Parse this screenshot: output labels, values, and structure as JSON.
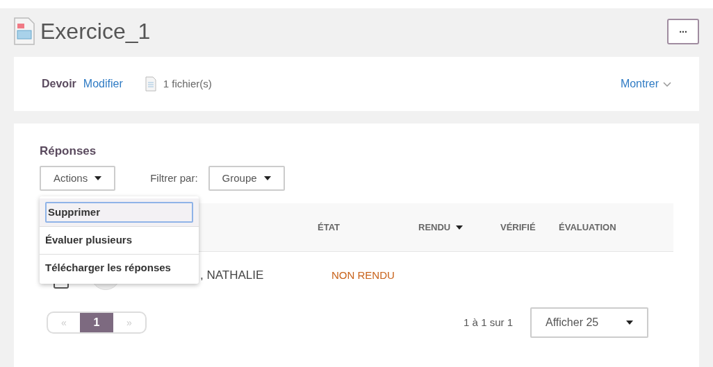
{
  "title": "Exercice_1",
  "more_button": "...",
  "assignment": {
    "label": "Devoir",
    "edit_link": "Modifier",
    "files": "1 fichier(s)",
    "show_link": "Montrer"
  },
  "responses": {
    "heading": "Réponses",
    "actions": {
      "label": "Actions",
      "expanded": true
    },
    "filter_label": "Filtrer par:",
    "filter": {
      "label": "Groupe"
    },
    "menu": [
      {
        "label": "Supprimer",
        "selected": true
      },
      {
        "label": "Évaluer plusieurs",
        "selected": false
      },
      {
        "label": "Télécharger les réponses",
        "selected": false
      }
    ],
    "columns": [
      {
        "label": "ÉTAT",
        "sorted": false
      },
      {
        "label": "RENDU",
        "sorted": true
      },
      {
        "label": "VÉRIFIÉ",
        "sorted": false
      },
      {
        "label": "ÉVALUATION",
        "sorted": false
      }
    ],
    "rows": [
      {
        "checked": false,
        "name": ", NATHALIE",
        "state": "NON RENDU"
      }
    ],
    "pagination": {
      "prev": {
        "label": "«",
        "disabled": true
      },
      "pages": [
        {
          "label": "1",
          "selected": true
        }
      ],
      "next": {
        "label": "»",
        "disabled": true
      }
    },
    "range": "1 à 1 sur 1",
    "page_size": "Afficher 25"
  }
}
